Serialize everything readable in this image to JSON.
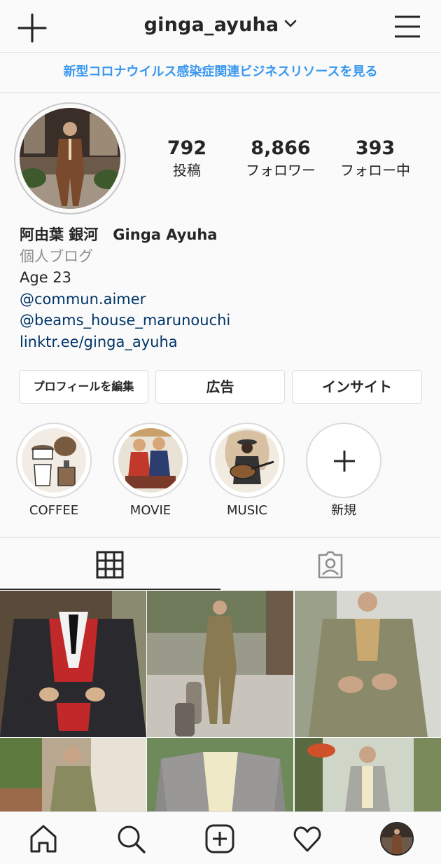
{
  "header": {
    "username": "ginga_ayuha",
    "new_post_icon": "plus-icon",
    "menu_icon": "hamburger-menu-icon",
    "dropdown_icon": "chevron-down-icon"
  },
  "banner": {
    "text": "新型コロナウイルス感染症関連ビジネスリソースを見る",
    "color": "#3897f0"
  },
  "stats": {
    "posts": {
      "value": "792",
      "label": "投稿"
    },
    "followers": {
      "value": "8,866",
      "label": "フォロワー"
    },
    "following": {
      "value": "393",
      "label": "フォロー中"
    }
  },
  "bio": {
    "name": "阿由葉 銀河　Ginga Ayuha",
    "category": "個人ブログ",
    "lines": [
      "Age 23"
    ],
    "links": [
      "@commun.aimer",
      "@beams_house_marunouchi",
      "linktr.ee/ginga_ayuha"
    ]
  },
  "buttons": {
    "edit_profile": "プロフィールを編集",
    "ad": "広告",
    "insights": "インサイト"
  },
  "highlights": [
    {
      "label": "COFFEE"
    },
    {
      "label": "MOVIE"
    },
    {
      "label": "MUSIC"
    },
    {
      "label": "新規"
    }
  ],
  "tabs": {
    "grid_icon": "grid-icon",
    "tagged_icon": "tagged-person-icon"
  },
  "bottom_nav": [
    "home-icon",
    "search-icon",
    "new-post-icon",
    "activity-heart-icon",
    "profile-avatar"
  ],
  "colors": {
    "link": "#003569",
    "accent": "#3897f0",
    "border": "#dbdbdb",
    "text": "#262626",
    "muted": "#8e8e8e"
  }
}
